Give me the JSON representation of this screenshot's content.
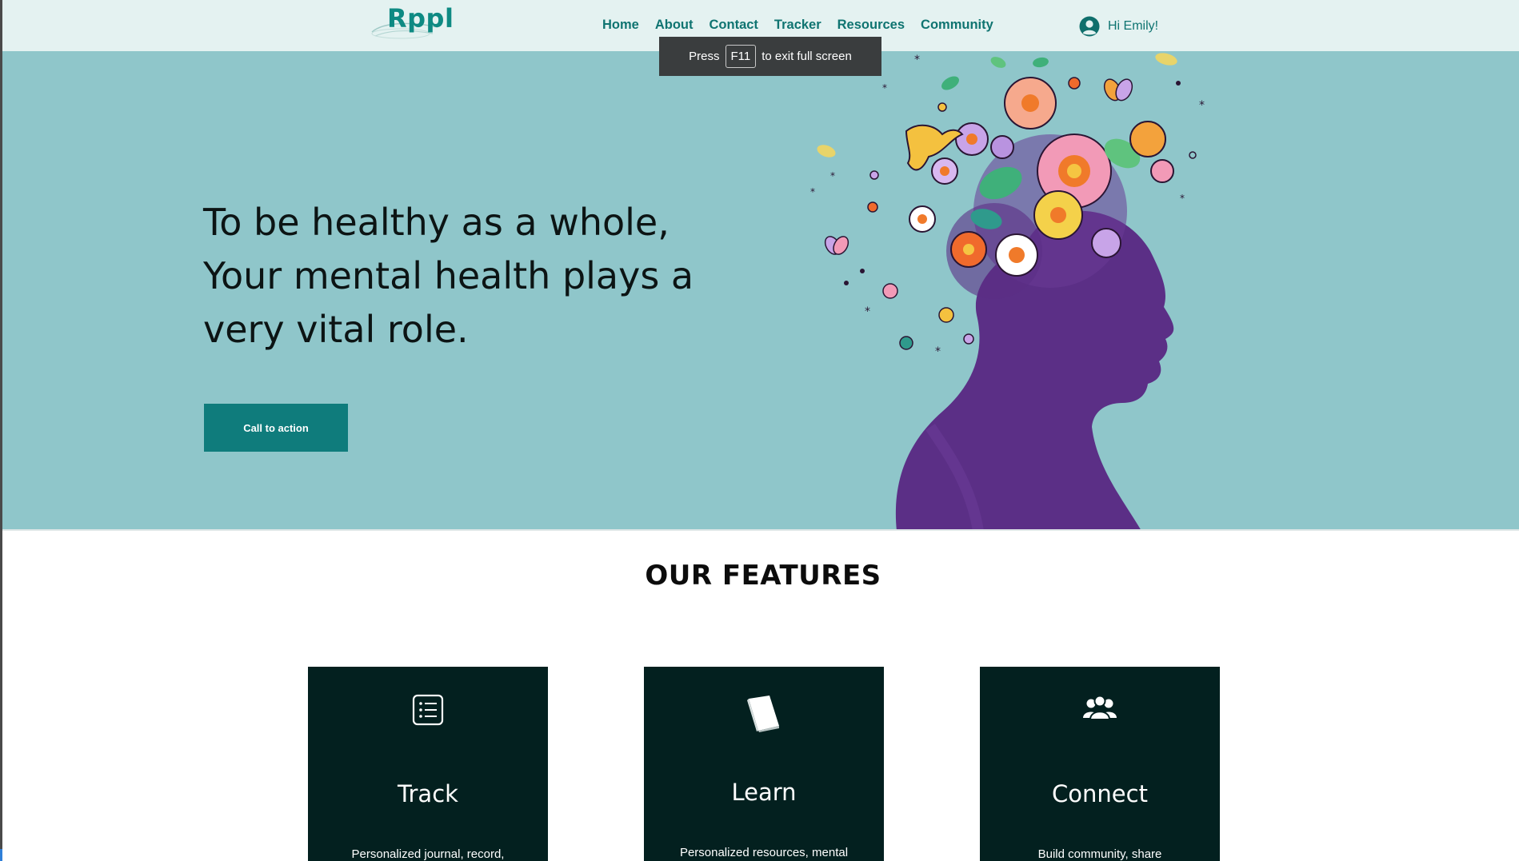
{
  "header": {
    "logo_text": "Rppl",
    "nav": [
      "Home",
      "About",
      "Contact",
      "Tracker",
      "Resources",
      "Community"
    ],
    "greeting": "Hi Emily!",
    "user_icon": "account-circle-icon"
  },
  "fullscreen_notice": {
    "prefix": "Press",
    "key": "F11",
    "suffix": "to exit full screen"
  },
  "hero": {
    "headline": "To be healthy as a whole, Your mental health plays a very vital role.",
    "cta_label": "Call to action",
    "illustration": "flower-head-silhouette-illustration"
  },
  "features": {
    "title": "OUR FEATURES",
    "cards": [
      {
        "title": "Track",
        "desc": "Personalized journal, record,",
        "icon": "list-icon"
      },
      {
        "title": "Learn",
        "desc": "Personalized resources, mental",
        "icon": "book-icon"
      },
      {
        "title": "Connect",
        "desc": "Build community, share",
        "icon": "group-icon"
      }
    ]
  },
  "colors": {
    "brand": "#0e8a83",
    "nav_text": "#0f7471",
    "header_bg": "#e4f2f1",
    "hero_bg": "#8fc6ca",
    "cta_bg": "#0f7c7c",
    "card_bg": "#03201f",
    "silhouette": "#5b2f86"
  }
}
